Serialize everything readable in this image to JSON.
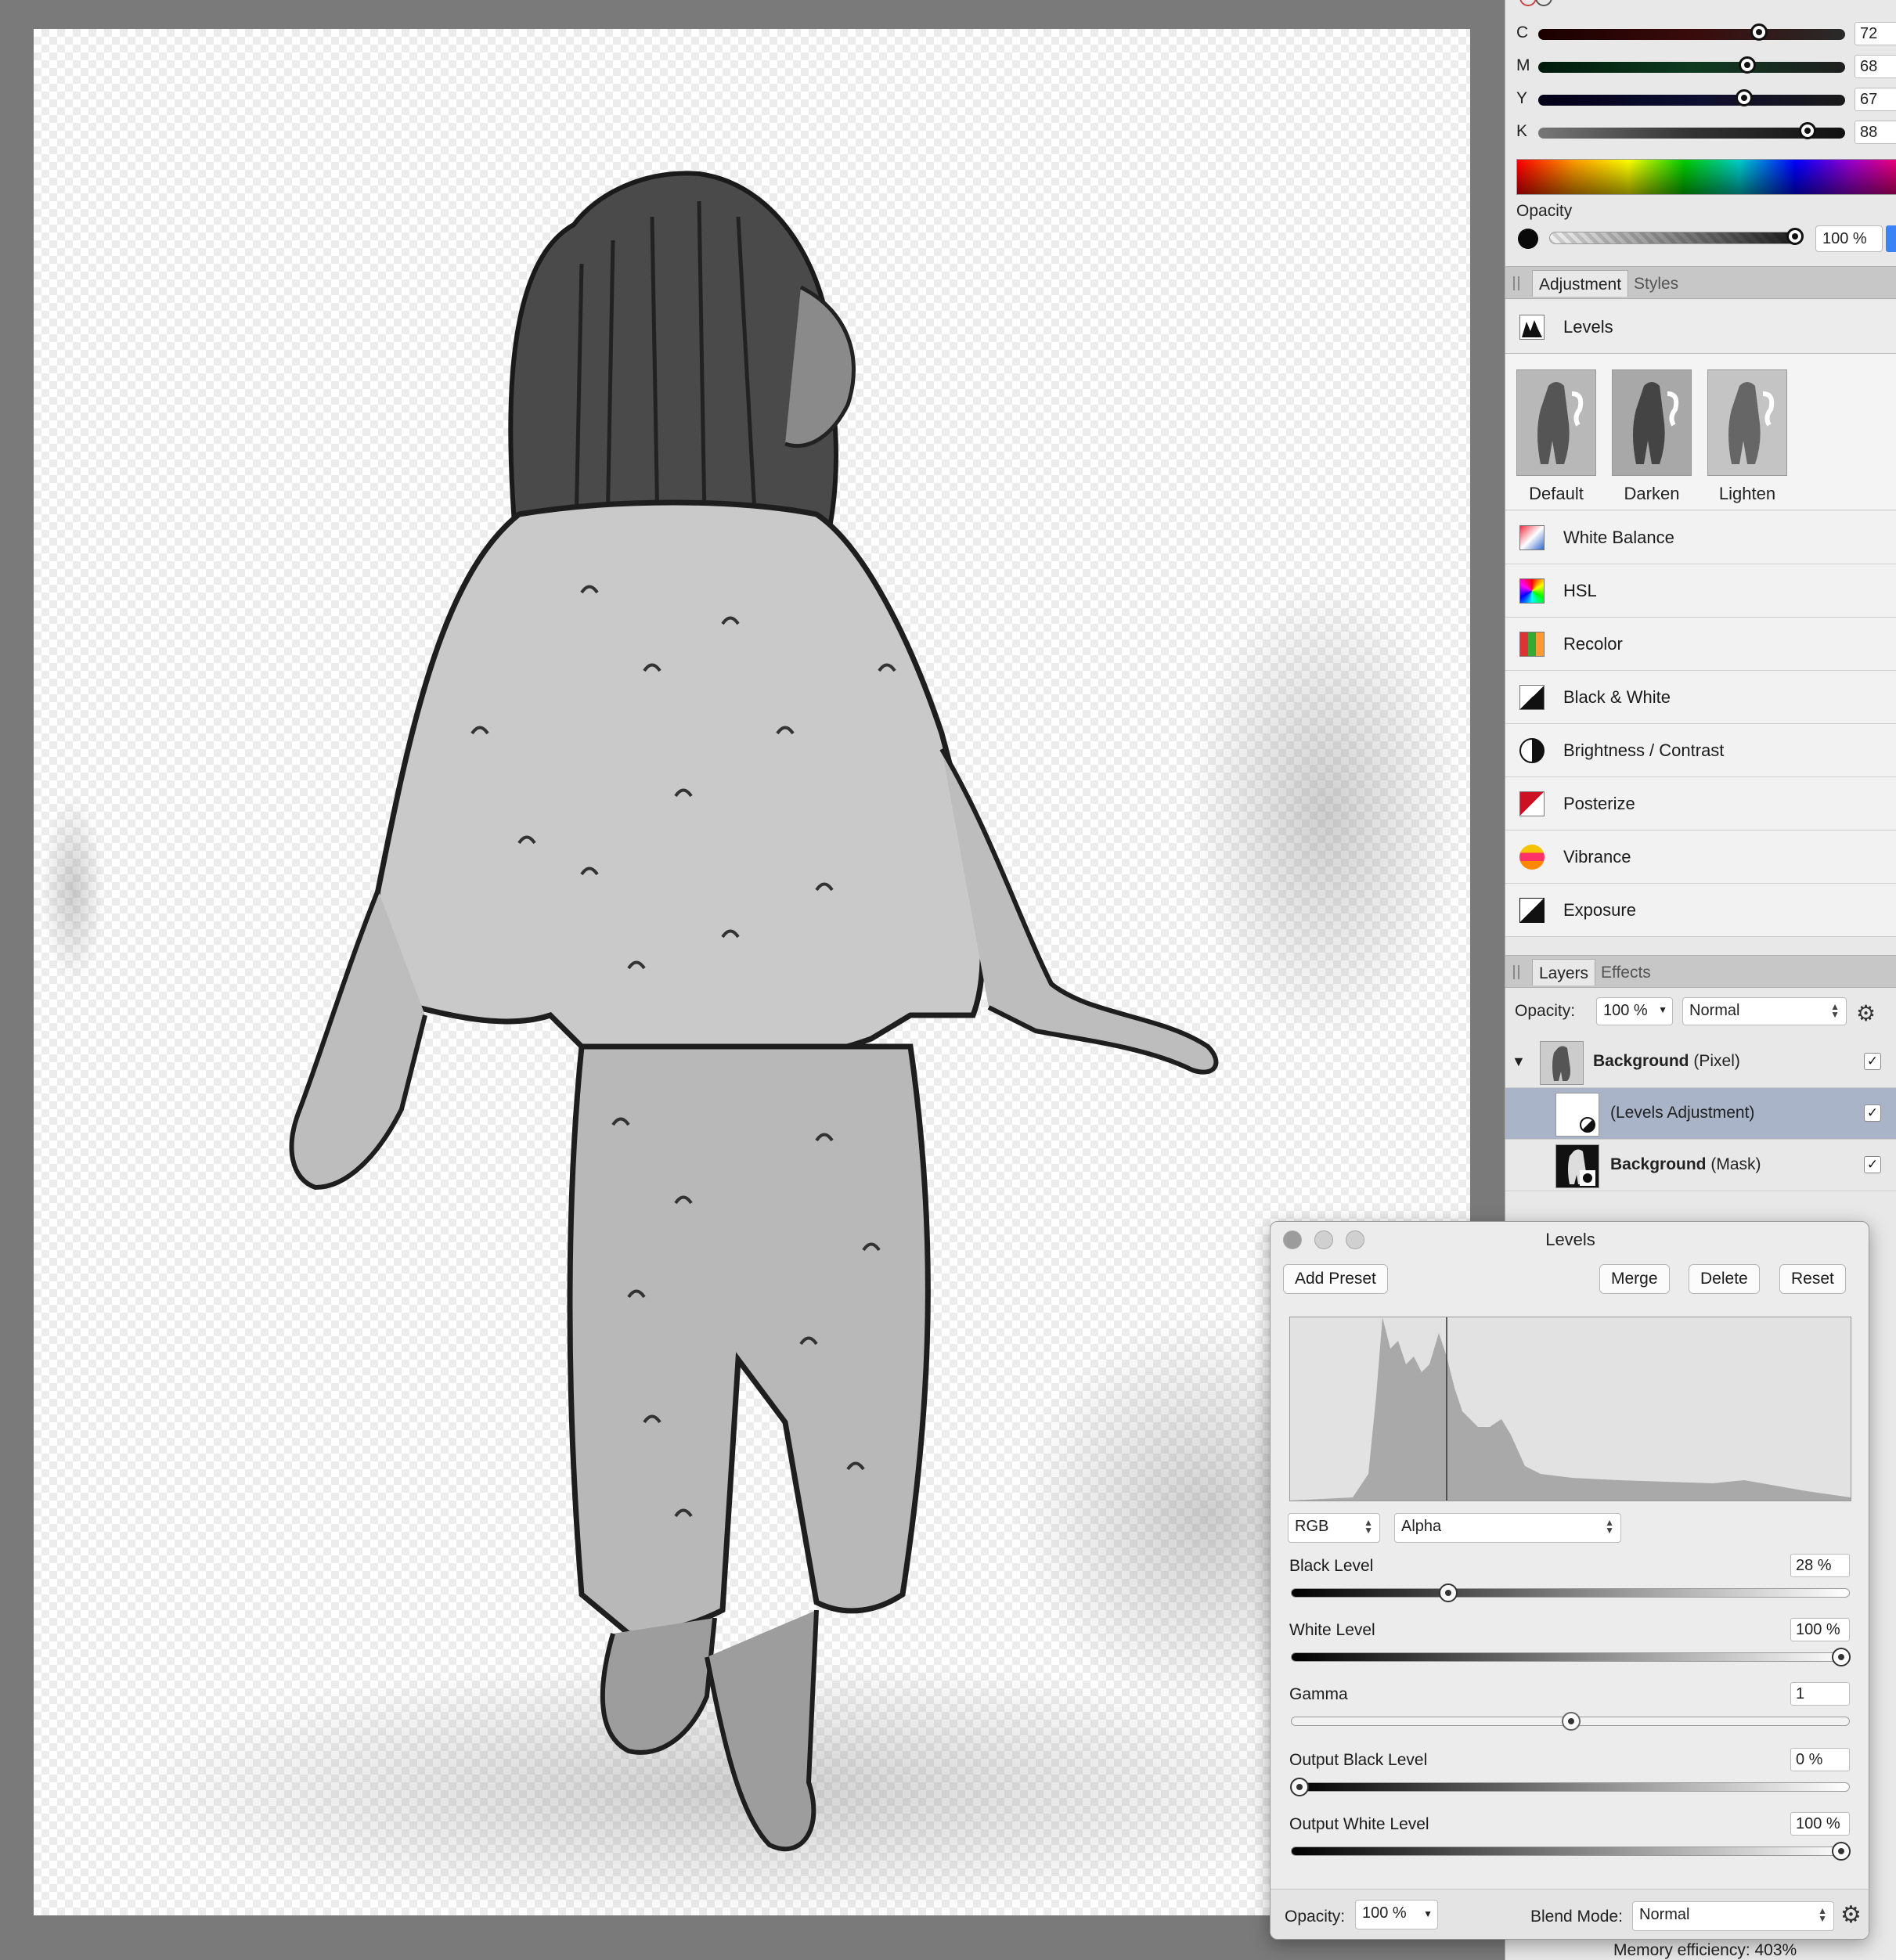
{
  "colors": {
    "panel_bg": "#e8e8e8",
    "selection": "#a9b4c8",
    "accent_blue": "#3b82f6"
  },
  "color_panel": {
    "channels": [
      {
        "label": "C",
        "value": "72",
        "level": 0.72
      },
      {
        "label": "M",
        "value": "68",
        "level": 0.68
      },
      {
        "label": "Y",
        "value": "67",
        "level": 0.67
      },
      {
        "label": "K",
        "value": "88",
        "level": 0.88
      }
    ],
    "opacity_label": "Opacity",
    "opacity_value": "100 %"
  },
  "adjustment_panel": {
    "tabs": [
      "Adjustment",
      "Styles"
    ],
    "selected": "Levels",
    "presets": [
      "Default",
      "Darken",
      "Lighten"
    ],
    "items": [
      {
        "label": "White Balance",
        "icon": "white-balance-icon"
      },
      {
        "label": "HSL",
        "icon": "hsl-icon"
      },
      {
        "label": "Recolor",
        "icon": "recolor-icon"
      },
      {
        "label": "Black & White",
        "icon": "black-white-icon"
      },
      {
        "label": "Brightness / Contrast",
        "icon": "brightness-contrast-icon"
      },
      {
        "label": "Posterize",
        "icon": "posterize-icon"
      },
      {
        "label": "Vibrance",
        "icon": "vibrance-icon"
      },
      {
        "label": "Exposure",
        "icon": "exposure-icon"
      }
    ]
  },
  "layers_panel": {
    "tabs": [
      "Layers",
      "Effects"
    ],
    "opacity_label": "Opacity:",
    "opacity_value": "100 %",
    "blend_mode": "Normal",
    "layers": [
      {
        "name": "Background",
        "type": "(Pixel)"
      },
      {
        "name": "",
        "type": "(Levels Adjustment)"
      },
      {
        "name": "Background",
        "type": "(Mask)"
      }
    ]
  },
  "levels_dialog": {
    "title": "Levels",
    "buttons": {
      "add_preset": "Add Preset",
      "merge": "Merge",
      "delete": "Delete",
      "reset": "Reset"
    },
    "channel": "RGB",
    "mode": "Alpha",
    "controls": [
      {
        "label": "Black Level",
        "value": "28 %",
        "level": 0.28
      },
      {
        "label": "White Level",
        "value": "100 %",
        "level": 1.0
      },
      {
        "label": "Gamma",
        "value": "1",
        "level": 0.5
      },
      {
        "label": "Output Black Level",
        "value": "0 %",
        "level": 0.0
      },
      {
        "label": "Output White Level",
        "value": "100 %",
        "level": 1.0
      }
    ],
    "opacity_label": "Opacity:",
    "opacity_value": "100 %",
    "blend_mode_label": "Blend Mode:",
    "blend_mode": "Normal"
  },
  "status": {
    "memory": "Memory efficiency: 403%"
  }
}
